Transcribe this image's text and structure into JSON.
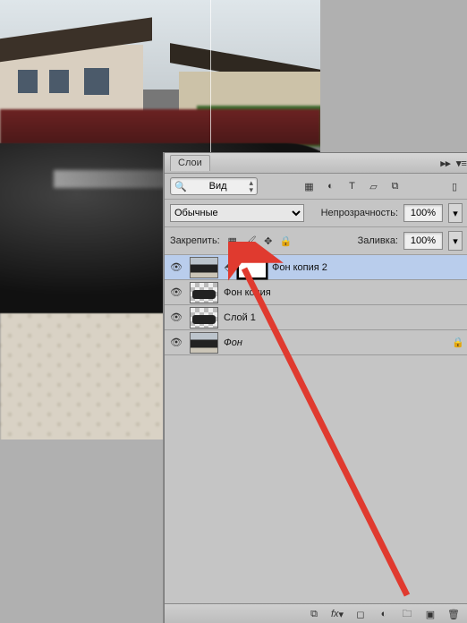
{
  "panel": {
    "title": "Слои",
    "filter": {
      "mode": "Вид"
    },
    "type_filters": [
      "pixel",
      "adjust",
      "type",
      "shape",
      "smart"
    ],
    "blend": {
      "mode": "Обычные",
      "opacity_label": "Непрозрачность:",
      "opacity": "100%",
      "fill_label": "Заливка:",
      "fill": "100%"
    },
    "lock_label": "Закрепить:"
  },
  "layers": [
    {
      "name": "Фон копия 2",
      "has_mask": true,
      "selected": true,
      "thumb": "photo"
    },
    {
      "name": "Фон копия",
      "has_mask": false,
      "selected": false,
      "thumb": "checker"
    },
    {
      "name": "Слой 1",
      "has_mask": false,
      "selected": false,
      "thumb": "checker"
    },
    {
      "name": "Фон",
      "has_mask": false,
      "selected": false,
      "thumb": "photo",
      "locked": true,
      "italic": true
    }
  ],
  "footer_icons": [
    "link",
    "fx",
    "mask",
    "adjustment",
    "group",
    "new",
    "delete"
  ]
}
